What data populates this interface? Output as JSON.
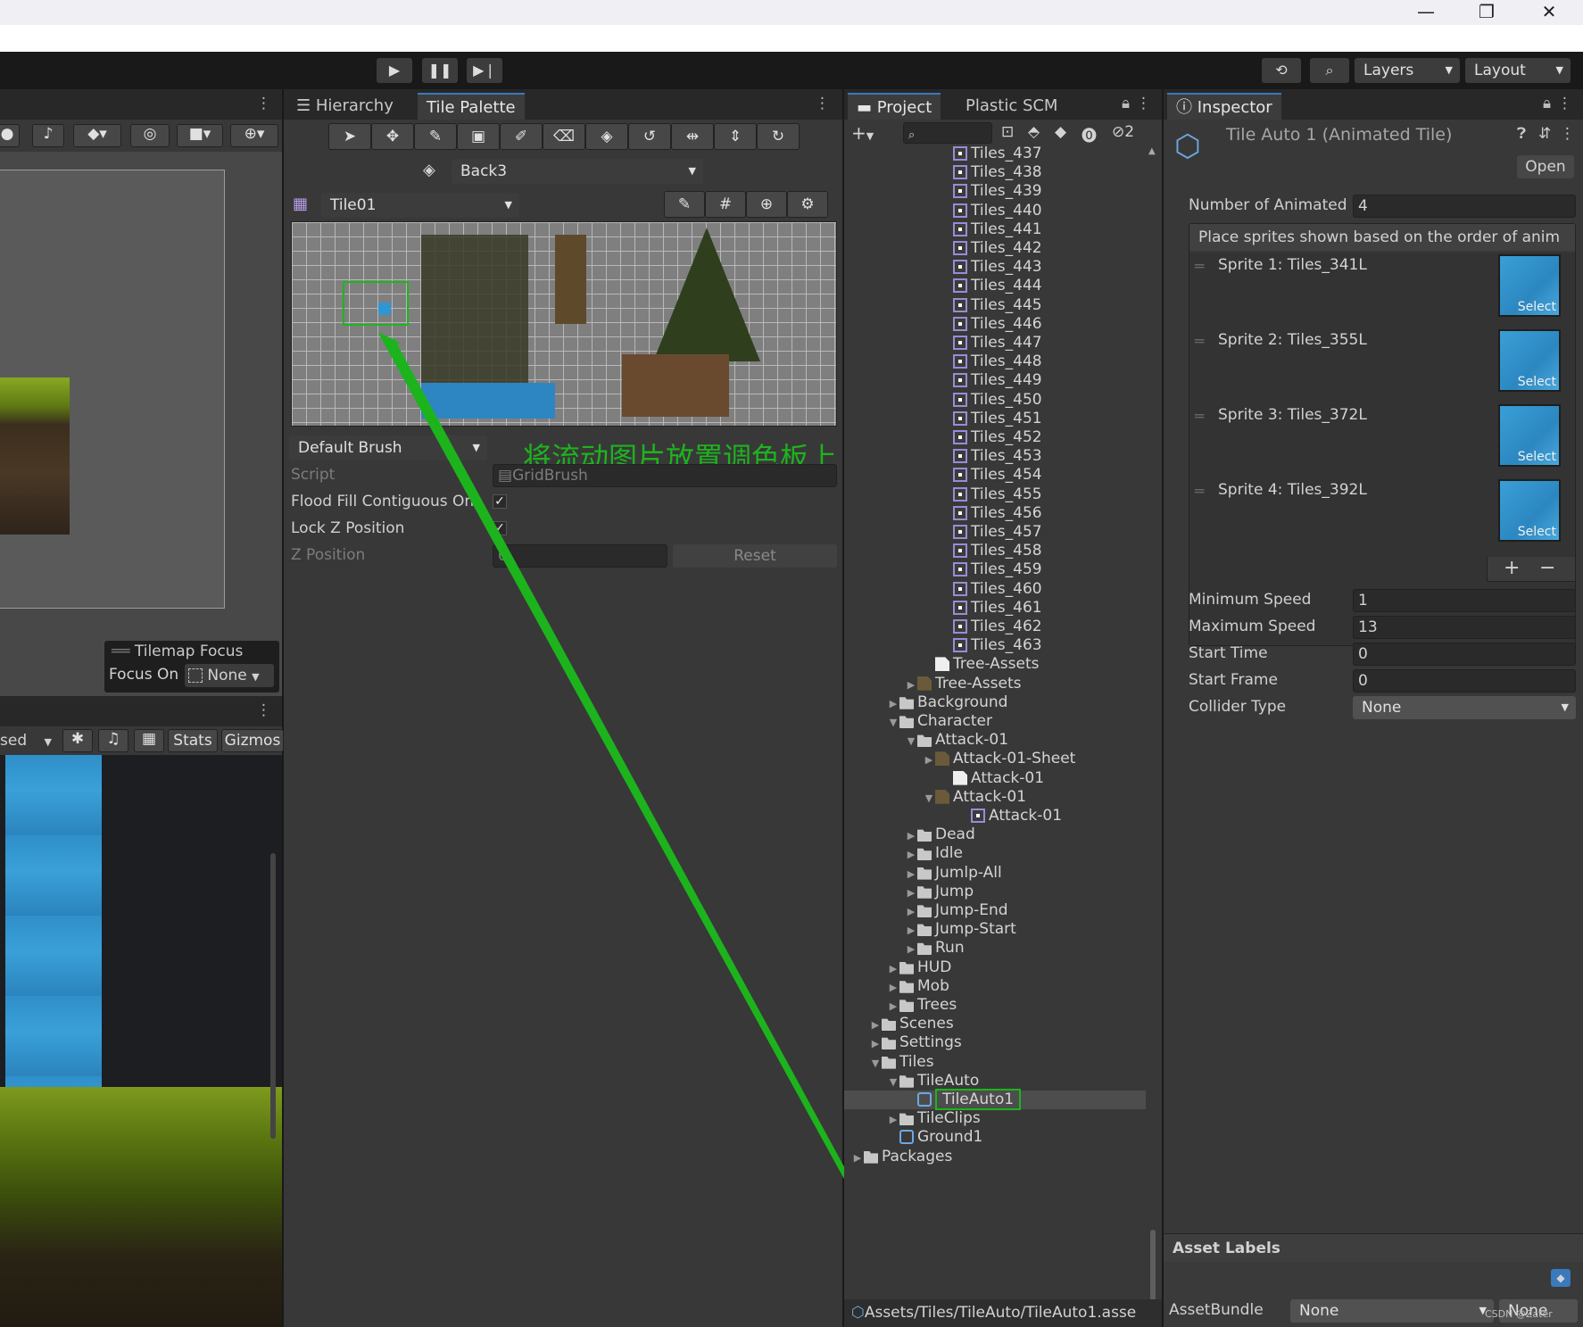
{
  "window": {
    "minimize": "—",
    "maximize": "❐",
    "close": "✕"
  },
  "toolbar": {
    "play_icon": "play-icon",
    "pause_icon": "pause-icon",
    "step_icon": "step-icon",
    "layers_label": "Layers",
    "layout_label": "Layout"
  },
  "scene_panel": {
    "tilemap_focus_title": "Tilemap Focus",
    "focus_on_label": "Focus On",
    "focus_on_value": "None"
  },
  "game_panel": {
    "toolbar_partial": "sed",
    "stats_label": "Stats",
    "gizmos_label": "Gizmos"
  },
  "palette_panel": {
    "tabs": [
      "Hierarchy",
      "Tile Palette"
    ],
    "active_tab": "Tile Palette",
    "target_layer": "Back3",
    "palette_name": "Tile01",
    "brush_name": "Default Brush",
    "annotation": "将流动图片放置调色板上",
    "script_label": "Script",
    "script_value": "GridBrush",
    "flood_fill_label": "Flood Fill Contiguous Onl",
    "flood_fill_checked": true,
    "lock_z_label": "Lock Z Position",
    "lock_z_checked": true,
    "z_position_label": "Z Position",
    "z_position_value": "0",
    "reset_label": "Reset"
  },
  "project_panel": {
    "tabs": [
      "Project",
      "Plastic SCM"
    ],
    "active_tab": "Project",
    "hidden_count": "2",
    "tree": [
      {
        "label": "Tiles_437",
        "indent": 5,
        "icon": "sprite"
      },
      {
        "label": "Tiles_438",
        "indent": 5,
        "icon": "sprite"
      },
      {
        "label": "Tiles_439",
        "indent": 5,
        "icon": "sprite"
      },
      {
        "label": "Tiles_440",
        "indent": 5,
        "icon": "sprite"
      },
      {
        "label": "Tiles_441",
        "indent": 5,
        "icon": "sprite"
      },
      {
        "label": "Tiles_442",
        "indent": 5,
        "icon": "sprite"
      },
      {
        "label": "Tiles_443",
        "indent": 5,
        "icon": "sprite"
      },
      {
        "label": "Tiles_444",
        "indent": 5,
        "icon": "sprite"
      },
      {
        "label": "Tiles_445",
        "indent": 5,
        "icon": "sprite"
      },
      {
        "label": "Tiles_446",
        "indent": 5,
        "icon": "sprite"
      },
      {
        "label": "Tiles_447",
        "indent": 5,
        "icon": "sprite"
      },
      {
        "label": "Tiles_448",
        "indent": 5,
        "icon": "sprite"
      },
      {
        "label": "Tiles_449",
        "indent": 5,
        "icon": "sprite"
      },
      {
        "label": "Tiles_450",
        "indent": 5,
        "icon": "sprite"
      },
      {
        "label": "Tiles_451",
        "indent": 5,
        "icon": "sprite"
      },
      {
        "label": "Tiles_452",
        "indent": 5,
        "icon": "sprite"
      },
      {
        "label": "Tiles_453",
        "indent": 5,
        "icon": "sprite"
      },
      {
        "label": "Tiles_454",
        "indent": 5,
        "icon": "sprite"
      },
      {
        "label": "Tiles_455",
        "indent": 5,
        "icon": "sprite"
      },
      {
        "label": "Tiles_456",
        "indent": 5,
        "icon": "sprite"
      },
      {
        "label": "Tiles_457",
        "indent": 5,
        "icon": "sprite"
      },
      {
        "label": "Tiles_458",
        "indent": 5,
        "icon": "sprite"
      },
      {
        "label": "Tiles_459",
        "indent": 5,
        "icon": "sprite"
      },
      {
        "label": "Tiles_460",
        "indent": 5,
        "icon": "sprite"
      },
      {
        "label": "Tiles_461",
        "indent": 5,
        "icon": "sprite"
      },
      {
        "label": "Tiles_462",
        "indent": 5,
        "icon": "sprite"
      },
      {
        "label": "Tiles_463",
        "indent": 5,
        "icon": "sprite"
      },
      {
        "label": "Tree-Assets",
        "indent": 4,
        "icon": "file"
      },
      {
        "label": "Tree-Assets",
        "indent": 3,
        "icon": "image",
        "fold": "▶"
      },
      {
        "label": "Background",
        "indent": 2,
        "icon": "folder",
        "fold": "▶"
      },
      {
        "label": "Character",
        "indent": 2,
        "icon": "folder",
        "fold": "▼"
      },
      {
        "label": "Attack-01",
        "indent": 3,
        "icon": "folder",
        "fold": "▼"
      },
      {
        "label": "Attack-01-Sheet",
        "indent": 4,
        "icon": "image",
        "fold": "▶"
      },
      {
        "label": "Attack-01",
        "indent": 5,
        "icon": "file"
      },
      {
        "label": "Attack-01",
        "indent": 4,
        "icon": "image",
        "fold": "▼"
      },
      {
        "label": "Attack-01",
        "indent": 6,
        "icon": "sprite"
      },
      {
        "label": "Dead",
        "indent": 3,
        "icon": "folder",
        "fold": "▶"
      },
      {
        "label": "Idle",
        "indent": 3,
        "icon": "folder",
        "fold": "▶"
      },
      {
        "label": "Jumlp-All",
        "indent": 3,
        "icon": "folder",
        "fold": "▶"
      },
      {
        "label": "Jump",
        "indent": 3,
        "icon": "folder",
        "fold": "▶"
      },
      {
        "label": "Jump-End",
        "indent": 3,
        "icon": "folder",
        "fold": "▶"
      },
      {
        "label": "Jump-Start",
        "indent": 3,
        "icon": "folder",
        "fold": "▶"
      },
      {
        "label": "Run",
        "indent": 3,
        "icon": "folder",
        "fold": "▶"
      },
      {
        "label": "HUD",
        "indent": 2,
        "icon": "folder",
        "fold": "▶"
      },
      {
        "label": "Mob",
        "indent": 2,
        "icon": "folder",
        "fold": "▶"
      },
      {
        "label": "Trees",
        "indent": 2,
        "icon": "folder",
        "fold": "▶"
      },
      {
        "label": "Scenes",
        "indent": 1,
        "icon": "folder",
        "fold": "▶"
      },
      {
        "label": "Settings",
        "indent": 1,
        "icon": "folder",
        "fold": "▶"
      },
      {
        "label": "Tiles",
        "indent": 1,
        "icon": "folder",
        "fold": "▼"
      },
      {
        "label": "TileAuto",
        "indent": 2,
        "icon": "folder",
        "fold": "▼"
      },
      {
        "label": "TileAuto1",
        "indent": 3,
        "icon": "tile",
        "selected": true
      },
      {
        "label": "TileClips",
        "indent": 2,
        "icon": "folder",
        "fold": "▶"
      },
      {
        "label": "Ground1",
        "indent": 2,
        "icon": "tile"
      },
      {
        "label": "Packages",
        "indent": 0,
        "icon": "folder",
        "fold": "▶"
      }
    ],
    "status_path": "Assets/Tiles/TileAuto/TileAuto1.asse"
  },
  "inspector": {
    "tab": "Inspector",
    "title": "Tile Auto 1 (Animated Tile)",
    "open_label": "Open",
    "num_animated_label": "Number of Animated",
    "num_animated_value": "4",
    "list_header": "Place sprites shown based on the order of anim",
    "sprites": [
      {
        "label": "Sprite 1: Tiles_341L",
        "select": "Select"
      },
      {
        "label": "Sprite 2: Tiles_355L",
        "select": "Select"
      },
      {
        "label": "Sprite 3: Tiles_372L",
        "select": "Select"
      },
      {
        "label": "Sprite 4: Tiles_392L",
        "select": "Select"
      }
    ],
    "add_label": "+",
    "remove_label": "−",
    "min_speed_label": "Minimum Speed",
    "min_speed_value": "1",
    "max_speed_label": "Maximum Speed",
    "max_speed_value": "13",
    "start_time_label": "Start Time",
    "start_time_value": "0",
    "start_frame_label": "Start Frame",
    "start_frame_value": "0",
    "collider_label": "Collider Type",
    "collider_value": "None",
    "asset_labels_title": "Asset Labels",
    "assetbundle_label": "AssetBundle",
    "assetbundle_value": "None",
    "assetbundle_variant": "None",
    "watermark": "CSDN @Zater"
  },
  "colors": {
    "accent": "#3a79bb",
    "annotation_green": "#1db31d",
    "water": "#2c87c1"
  }
}
